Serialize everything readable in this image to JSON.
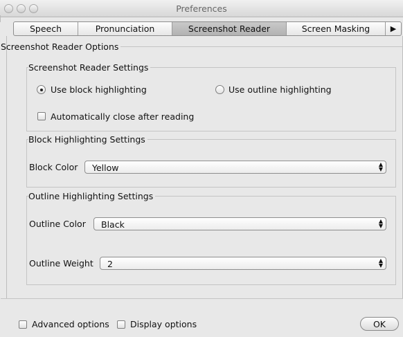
{
  "window": {
    "title": "Preferences"
  },
  "tabs": [
    {
      "label": "Speech"
    },
    {
      "label": "Pronunciation"
    },
    {
      "label": "Screenshot Reader"
    },
    {
      "label": "Screen Masking"
    }
  ],
  "tab_overflow_arrow": "▶",
  "options_group": {
    "title": "Screenshot Reader Options"
  },
  "reader_settings": {
    "title": "Screenshot Reader Settings",
    "block_radio_label": "Use block highlighting",
    "outline_radio_label": "Use outline highlighting",
    "auto_close_label": "Automatically close after reading",
    "selected": "block"
  },
  "block_settings": {
    "title": "Block Highlighting Settings",
    "color_label": "Block Color",
    "color_value": "Yellow"
  },
  "outline_settings": {
    "title": "Outline Highlighting Settings",
    "color_label": "Outline Color",
    "color_value": "Black",
    "weight_label": "Outline Weight",
    "weight_value": "2"
  },
  "footer": {
    "advanced_label": "Advanced options",
    "display_label": "Display options",
    "ok_label": "OK"
  },
  "colors": {
    "selected_tab": "#bcbcbc",
    "window_bg": "#e8e8e8"
  }
}
